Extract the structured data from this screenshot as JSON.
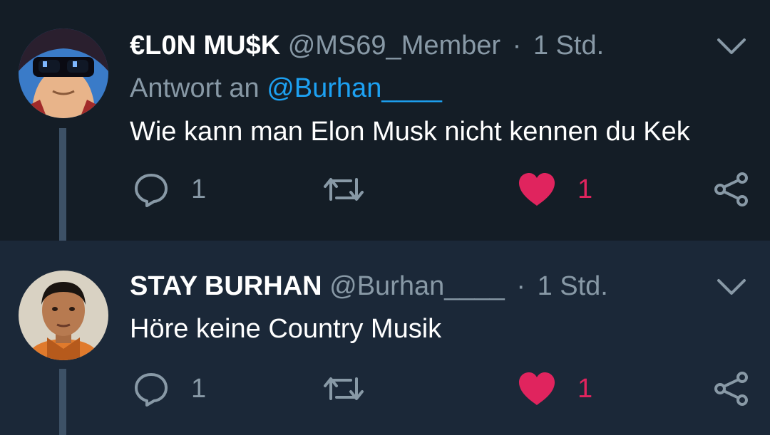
{
  "tweets": [
    {
      "display_name": "€L0N MU$K",
      "handle": "@MS69_Member",
      "separator": "·",
      "time": "1 Std.",
      "reply_prefix": "Antwort an",
      "reply_mention": "@Burhan____",
      "text": "Wie kann man Elon Musk nicht kennen du Kek",
      "reply_count": "1",
      "like_count": "1",
      "avatar_icon": "anime-avatar-with-sunglasses"
    },
    {
      "display_name": "STAY BURHAN",
      "handle": "@Burhan____",
      "separator": "·",
      "time": "1 Std.",
      "text": "Höre keine Country Musik",
      "reply_count": "1",
      "like_count": "1",
      "avatar_icon": "boy-portrait-avatar"
    }
  ],
  "colors": {
    "background_top": "#141d26",
    "background_bottom": "#1b2838",
    "text_primary": "#ffffff",
    "text_secondary": "#8899a6",
    "mention": "#1da1f2",
    "like": "#e0245e",
    "thread_line": "#3d5166"
  },
  "icons": [
    "reply-icon",
    "retweet-icon",
    "heart-icon",
    "share-icon",
    "chevron-down-icon"
  ]
}
